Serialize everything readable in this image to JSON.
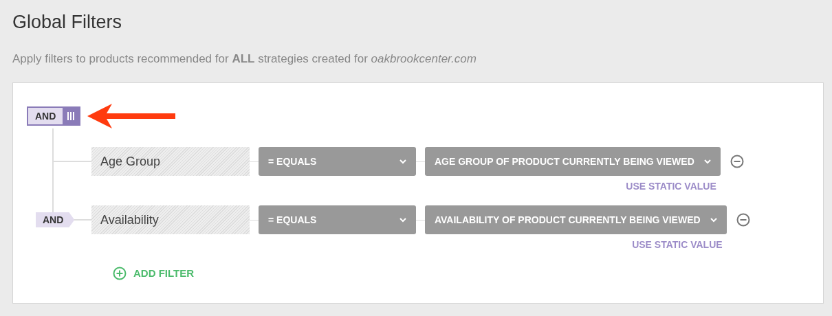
{
  "title": "Global Filters",
  "subtitle": "Apply filters to products recommended for **ALL** strategies created for *oakbrookcenter.com*",
  "root_operator": {
    "label": "AND"
  },
  "filters": [
    {
      "field": "Age Group",
      "operator": "= EQUALS",
      "value": "AGE GROUP OF PRODUCT CURRENTLY BEING VIEWED",
      "link": "USE STATIC VALUE"
    },
    {
      "join": "AND",
      "field": "Availability",
      "operator": "= EQUALS",
      "value": "AVAILABILITY OF PRODUCT CURRENTLY BEING VIEWED",
      "link": "USE STATIC VALUE"
    }
  ],
  "add_filter": "ADD FILTER"
}
